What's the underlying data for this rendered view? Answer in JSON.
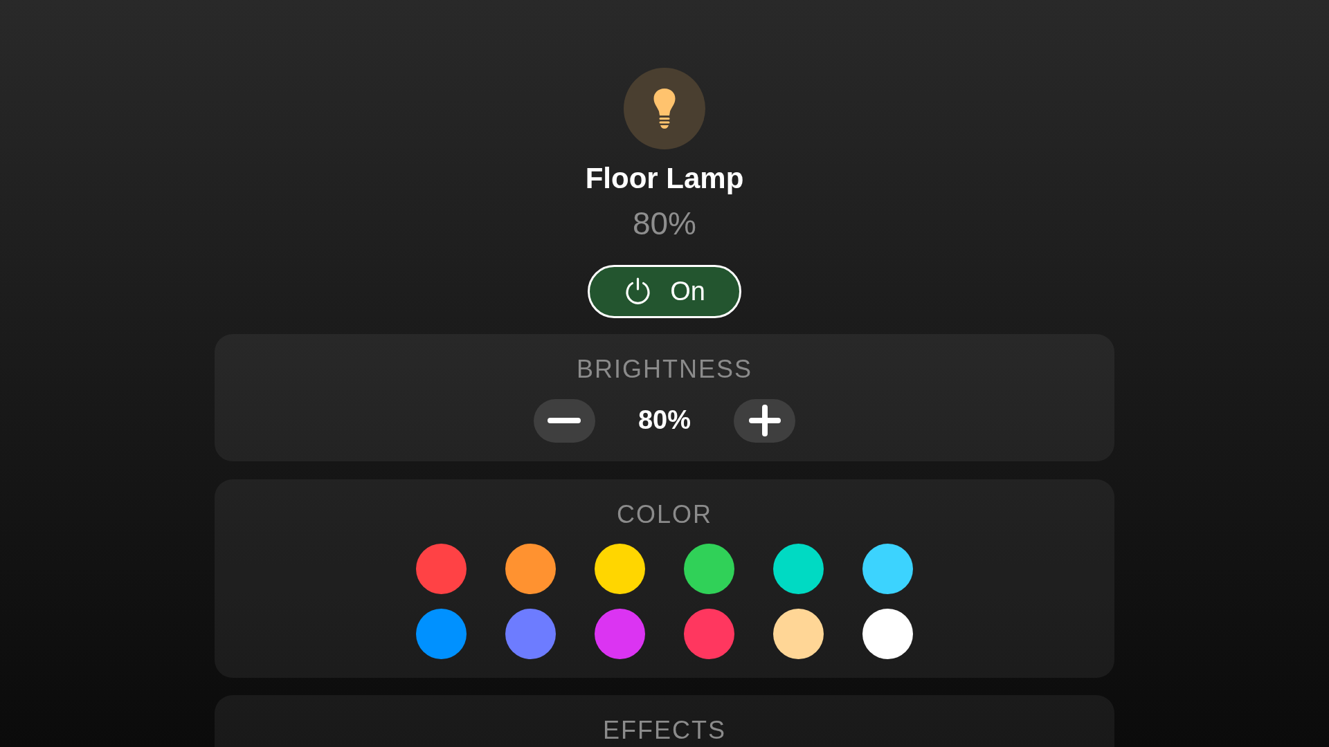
{
  "device": {
    "name": "Floor Lamp",
    "status": "80%",
    "power": {
      "label": "On",
      "on": true
    }
  },
  "brightness": {
    "title": "BRIGHTNESS",
    "value": "80%"
  },
  "color": {
    "title": "COLOR",
    "swatches": [
      {
        "color": "#ff4245",
        "selected": false
      },
      {
        "color": "#ff9230",
        "selected": false
      },
      {
        "color": "#ffd600",
        "selected": false
      },
      {
        "color": "#30d158",
        "selected": false
      },
      {
        "color": "#00dac3",
        "selected": false
      },
      {
        "color": "#3cd3fe",
        "selected": false
      },
      {
        "color": "#0091ff",
        "selected": false
      },
      {
        "color": "#6d7cff",
        "selected": false
      },
      {
        "color": "#db34f2",
        "selected": false
      },
      {
        "color": "#ff375f",
        "selected": false
      },
      {
        "color": "#ffd696",
        "selected": false
      },
      {
        "color": "#ffffff",
        "selected": false
      }
    ]
  },
  "effects": {
    "title": "EFFECTS"
  }
}
